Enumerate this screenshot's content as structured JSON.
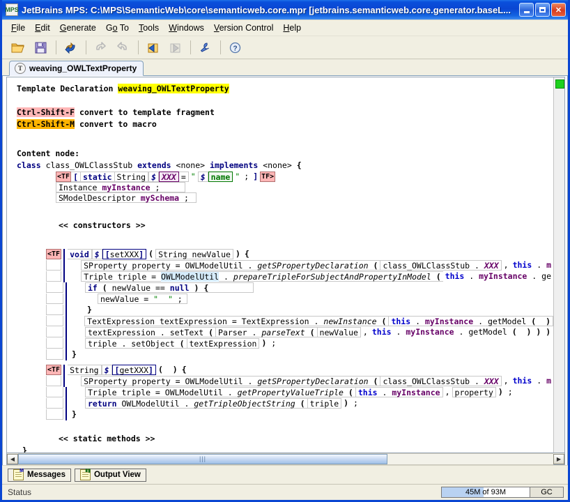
{
  "window": {
    "title": "JetBrains MPS: C:\\MPS\\SemanticWeb\\core\\semanticweb.core.mpr  [jetbrains.semanticweb.core.generator.baseL...",
    "app_icon_text": "MPS",
    "minimize_label": "_",
    "maximize_label": "□",
    "close_label": "✕"
  },
  "menu": {
    "items": [
      {
        "label": "File"
      },
      {
        "label": "Edit"
      },
      {
        "label": "Generate"
      },
      {
        "label": "Go To"
      },
      {
        "label": "Tools"
      },
      {
        "label": "Windows"
      },
      {
        "label": "Version Control"
      },
      {
        "label": "Help"
      }
    ]
  },
  "toolbar": {
    "buttons": [
      {
        "name": "open-project-icon",
        "title": "Open"
      },
      {
        "name": "save-icon",
        "title": "Save"
      },
      {
        "name": "refresh-icon",
        "title": "Regenerate"
      },
      {
        "name": "undo-icon",
        "title": "Undo"
      },
      {
        "name": "redo-icon",
        "title": "Redo"
      },
      {
        "name": "back-icon",
        "title": "Back"
      },
      {
        "name": "forward-icon",
        "title": "Forward"
      },
      {
        "name": "settings-wrench-icon",
        "title": "Settings"
      },
      {
        "name": "help-icon",
        "title": "Help"
      }
    ]
  },
  "tabs": [
    {
      "label": "weaving_OWLTextProperty",
      "icon": "T",
      "active": true
    }
  ],
  "editor": {
    "header": {
      "label": "Template Declaration",
      "name": "weaving_OWLTextProperty"
    },
    "shortcuts": [
      {
        "key": "Ctrl-Shift-F",
        "desc": "convert to template fragment",
        "style": "pink"
      },
      {
        "key": "Ctrl-Shift-M",
        "desc": "convert to macro",
        "style": "orange"
      }
    ],
    "content_node_label": "Content node:",
    "class_decl": {
      "kw_class": "class",
      "name": "class_OWLClassStub",
      "kw_extends": "extends",
      "extends_value": "<none>",
      "kw_implements": "implements",
      "implements_value": "<none>",
      "brace": "{"
    },
    "field_line": {
      "tf_open": "<TF",
      "bracket_open": "[",
      "static": "static",
      "type": "String",
      "dollar1": "$",
      "macro1": "XXX",
      "eq": "=",
      "quote_open": "\"",
      "dollar2": "$",
      "macro2": "name",
      "quote_close": "\"",
      "semi": ";",
      "bracket_close": "]",
      "tf_close": "TF>"
    },
    "fields": [
      {
        "type": "Instance",
        "name": "myInstance",
        "semi": ";"
      },
      {
        "type": "SModelDescriptor",
        "name": "mySchema",
        "semi": ";"
      }
    ],
    "constructors_label": "<< constructors >>",
    "static_methods_label": "<< static methods >>",
    "closing_brace": "}",
    "setter": {
      "tf": "<TF",
      "return_type": "void",
      "dollar": "$",
      "macro_name": "setXXX",
      "paren_open": "(",
      "param_type": "String",
      "param_name": "newValue",
      "paren_close": ")",
      "brace_open": "{",
      "brace_close": "}",
      "statements": [
        {
          "parts": [
            {
              "t": "SProperty property = OWLModelUtil",
              "s": "plain"
            },
            {
              "t": ".",
              "s": "plain"
            },
            {
              "t": "getSPropertyDeclaration",
              "s": "ital"
            },
            {
              "t": "(",
              "s": "bold"
            },
            {
              "t": "class_OWLClassStub",
              "s": "plain"
            },
            {
              "t": ".",
              "s": "plain"
            },
            {
              "t": "XXX",
              "s": "macro"
            },
            {
              "t": ",",
              "s": "plain"
            },
            {
              "t": "this",
              "s": "kw"
            },
            {
              "t": ".",
              "s": "plain"
            },
            {
              "t": "m",
              "s": "purple"
            }
          ]
        },
        {
          "parts": [
            {
              "t": "Triple triple =",
              "s": "plain"
            },
            {
              "t": "OWLModelUtil",
              "s": "hl"
            },
            {
              "t": ".",
              "s": "plain"
            },
            {
              "t": "prepareTripleForSubjectAndPropertyInModel",
              "s": "ital"
            },
            {
              "t": "(",
              "s": "bold"
            },
            {
              "t": "this",
              "s": "kw"
            },
            {
              "t": ".",
              "s": "plain"
            },
            {
              "t": "myInstance",
              "s": "purple"
            },
            {
              "t": ".",
              "s": "plain"
            },
            {
              "t": "ge",
              "s": "plain"
            }
          ]
        }
      ],
      "if_block": {
        "kw_if": "if",
        "paren_open": "(",
        "lhs": "newValue",
        "op": "==",
        "rhs": "null",
        "paren_close": ")",
        "brace_open": "{",
        "body": "newValue = \"   \" ;",
        "brace_close": "}"
      },
      "tail_statements": [
        "TextExpression textExpression = TextExpression . newInstance ( this . myInstance . getModel ( )",
        "textExpression . setText ( Parser . parseText ( newValue , this . myInstance . getModel ( ) ) )",
        "triple . setObject ( textExpression ) ;"
      ]
    },
    "getter": {
      "tf": "<TF",
      "return_type": "String",
      "dollar": "$",
      "macro_name": "getXXX",
      "paren_open": "(",
      "paren_close": ")",
      "brace_open": "{",
      "brace_close": "}",
      "statements": [
        "SProperty property = OWLModelUtil . getSPropertyDeclaration ( class_OWLClassStub . XXX , this . m",
        "Triple triple = OWLModelUtil . getPropertyValueTriple ( this . myInstance , property ) ;",
        "return OWLModelUtil . getTripleObjectString ( triple ) ;"
      ]
    }
  },
  "bottom": {
    "buttons": [
      {
        "label": "Messages",
        "icon": "messages-icon"
      },
      {
        "label": "Output View",
        "icon": "output-view-icon"
      }
    ]
  },
  "status": {
    "text": "Status",
    "memory": "45M of 93M",
    "gc_label": "GC"
  },
  "colors": {
    "title_blue": "#0a46d2",
    "highlight_yellow": "#ffff00",
    "highlight_orange": "#ffb400",
    "highlight_pink": "#ffb6b6",
    "keyword_navy": "#000080",
    "macro_purple": "#660066",
    "marker_green": "#1ed11e"
  }
}
